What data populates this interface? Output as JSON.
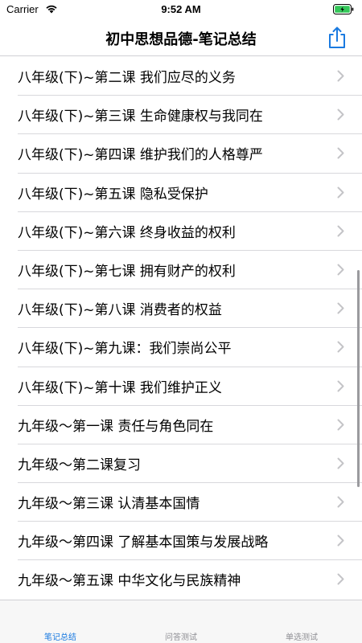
{
  "status_bar": {
    "carrier": "Carrier",
    "time": "9:52 AM",
    "wifi_icon": "wifi-icon",
    "battery_icon": "battery-icon"
  },
  "nav": {
    "title": "初中思想品德-笔记总结",
    "share_icon": "share-icon",
    "accent_color": "#1a7ae0"
  },
  "list": {
    "items": [
      "八年级(下)~第二课 我们应尽的义务",
      "八年级(下)~第三课  生命健康权与我同在",
      "八年级(下)~第四课  维护我们的人格尊严",
      "八年级(下)~第五课  隐私受保护",
      "八年级(下)~第六课 终身收益的权利",
      "八年级(下)~第七课 拥有财产的权利",
      "八年级(下)~第八课   消费者的权益",
      "八年级(下)~第九课：我们崇尚公平",
      "八年级(下)~第十课 我们维护正义",
      "九年级～第一课 责任与角色同在",
      "九年级～第二课复习",
      "九年级～第三课 认清基本国情",
      "九年级～第四课 了解基本国策与发展战略",
      "九年级～第五课 中华文化与民族精神"
    ]
  },
  "tab_bar": {
    "tabs": [
      {
        "label": "笔记总结",
        "active": true
      },
      {
        "label": "问答测试",
        "active": false
      },
      {
        "label": "单选测试",
        "active": false
      }
    ],
    "active_color": "#1a7ae0",
    "inactive_color": "#8e8e93"
  }
}
